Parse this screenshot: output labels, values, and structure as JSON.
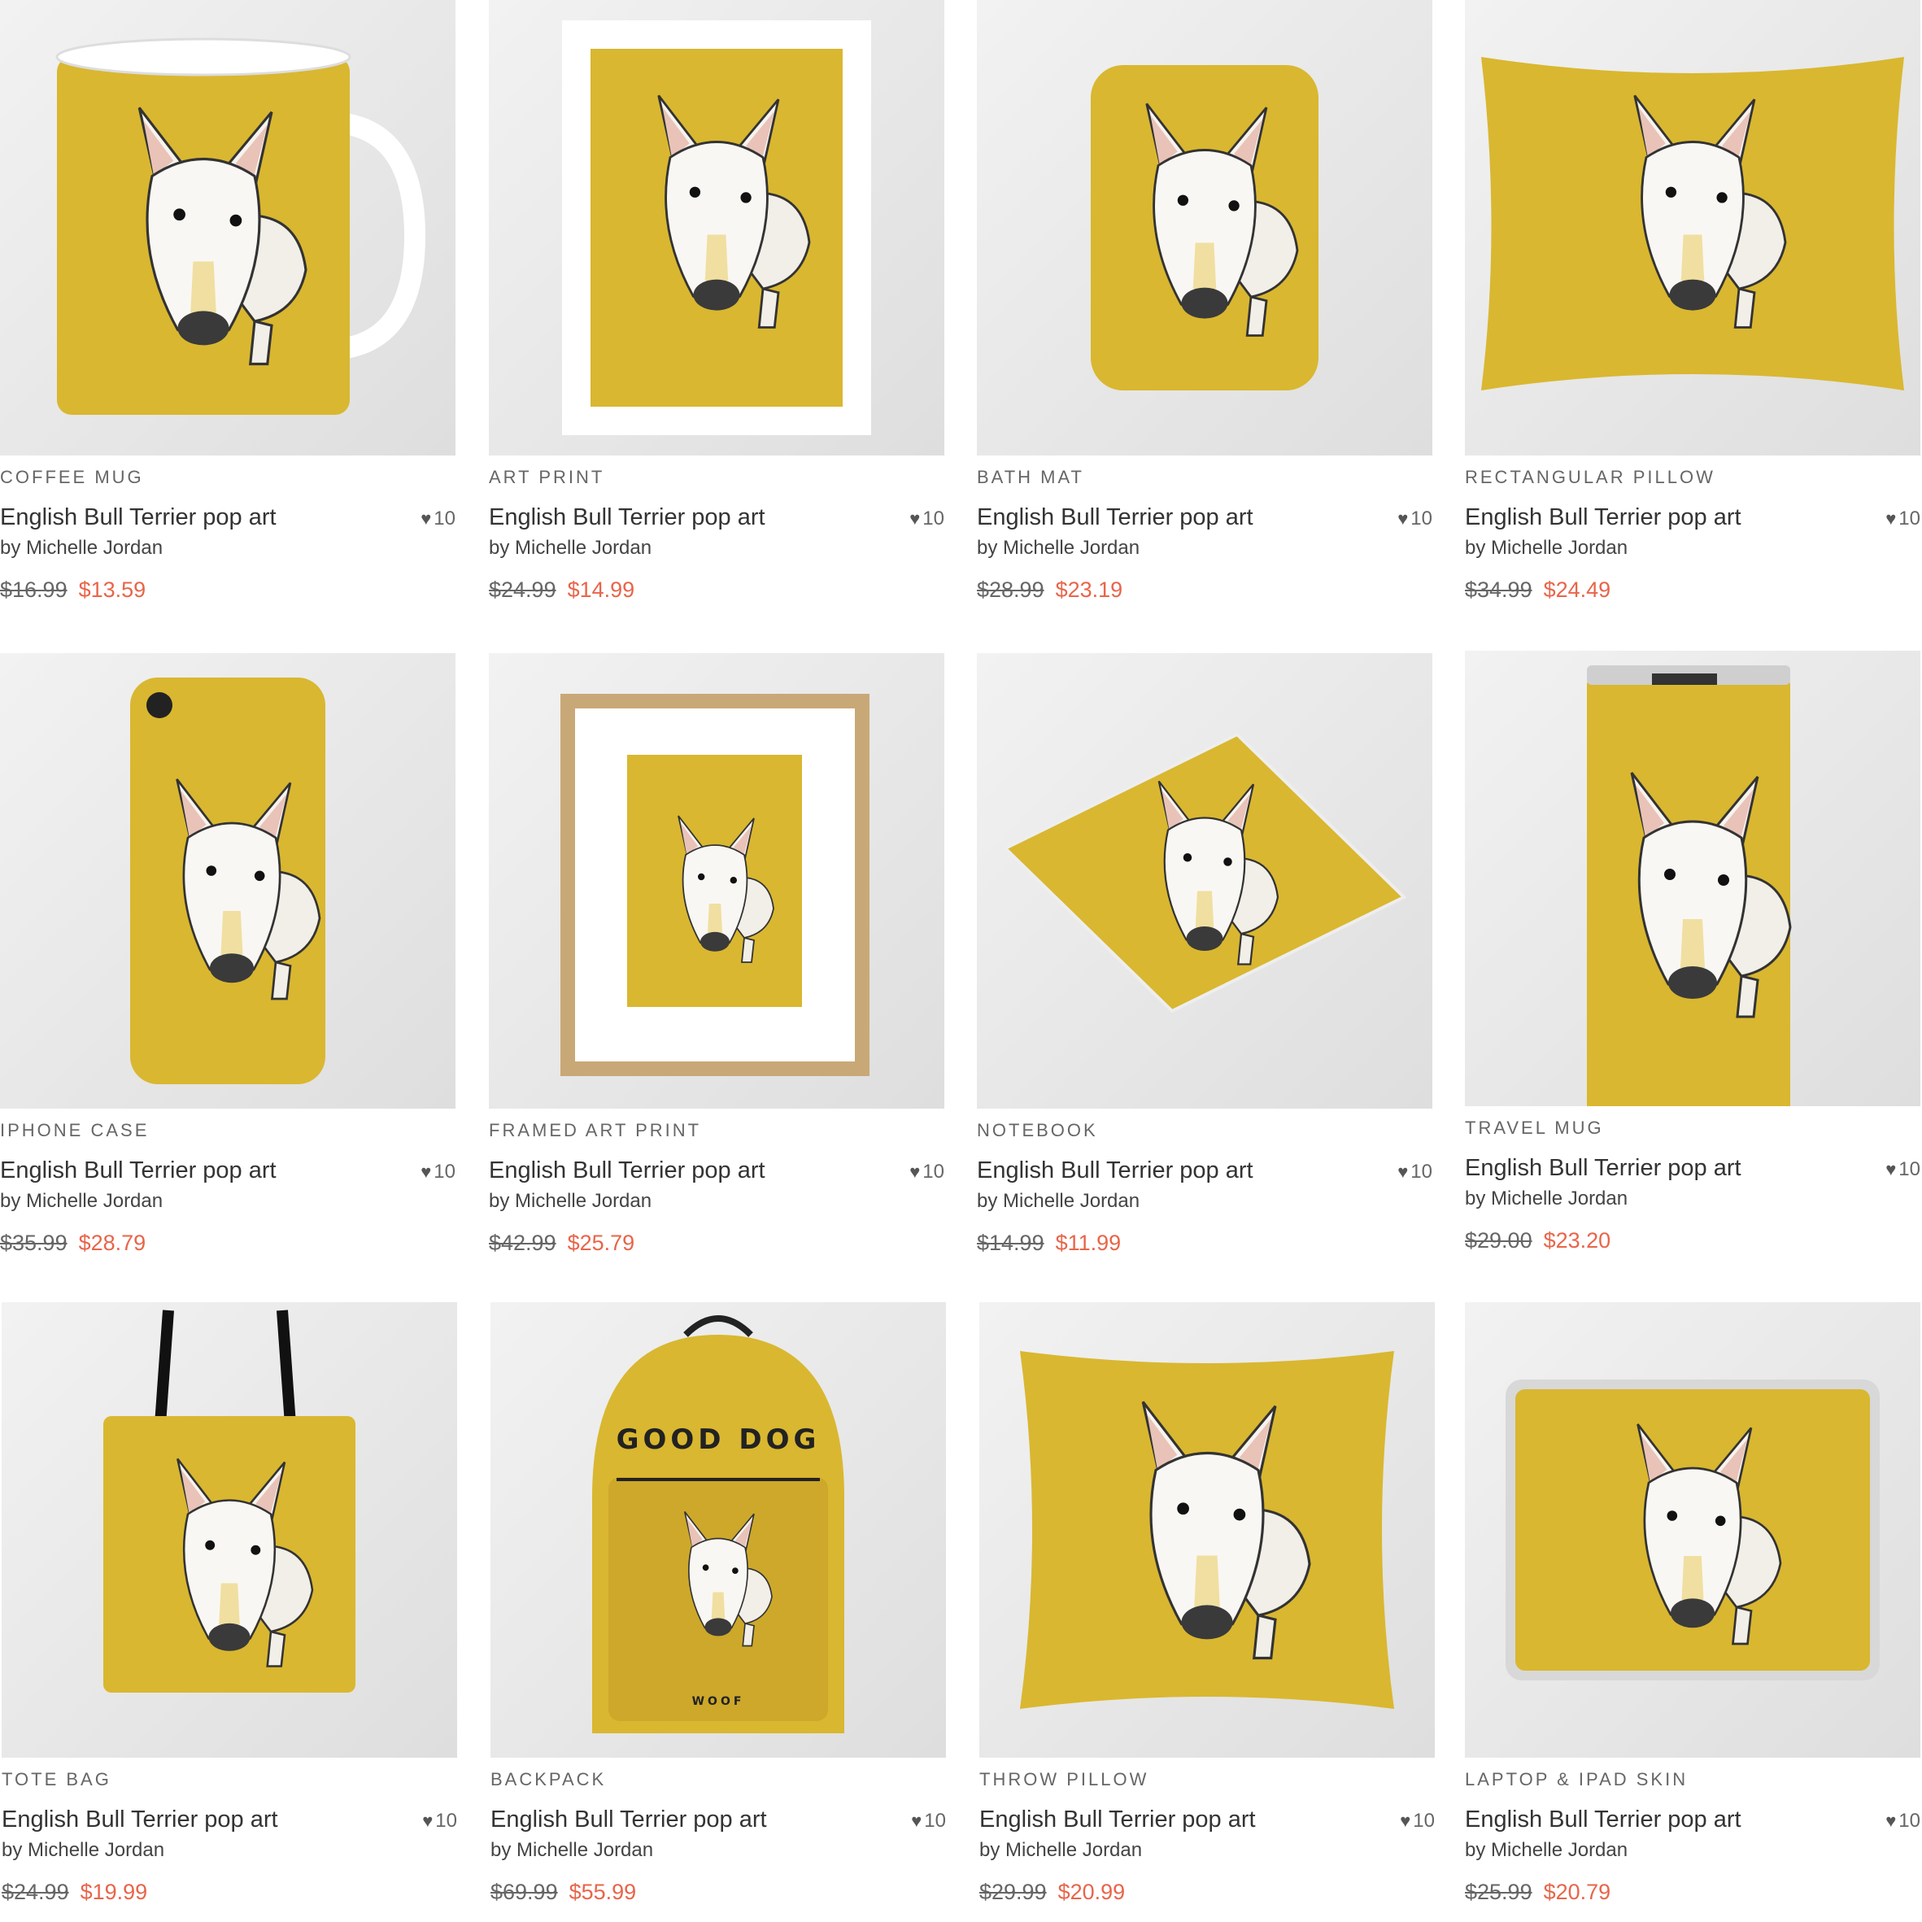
{
  "colors": {
    "price_sale": "#e8654a",
    "background_art": "#d9b730",
    "text": "#333333"
  },
  "products": [
    {
      "type": "COFFEE MUG",
      "title": "English Bull Terrier pop art",
      "artist": "by Michelle Jordan",
      "likes": "10",
      "old_price": "$16.99",
      "price": "$13.59",
      "shape": "mug"
    },
    {
      "type": "ART PRINT",
      "title": "English Bull Terrier pop art",
      "artist": "by Michelle Jordan",
      "likes": "10",
      "old_price": "$24.99",
      "price": "$14.99",
      "shape": "print"
    },
    {
      "type": "BATH MAT",
      "title": "English Bull Terrier pop art",
      "artist": "by Michelle Jordan",
      "likes": "10",
      "old_price": "$28.99",
      "price": "$23.19",
      "shape": "mat"
    },
    {
      "type": "RECTANGULAR PILLOW",
      "title": "English Bull Terrier pop art",
      "artist": "by Michelle Jordan",
      "likes": "10",
      "old_price": "$34.99",
      "price": "$24.49",
      "shape": "rectpillow"
    },
    {
      "type": "IPHONE CASE",
      "title": "English Bull Terrier pop art",
      "artist": "by Michelle Jordan",
      "likes": "10",
      "old_price": "$35.99",
      "price": "$28.79",
      "shape": "phone"
    },
    {
      "type": "FRAMED ART PRINT",
      "title": "English Bull Terrier pop art",
      "artist": "by Michelle Jordan",
      "likes": "10",
      "old_price": "$42.99",
      "price": "$25.79",
      "shape": "framed"
    },
    {
      "type": "NOTEBOOK",
      "title": "English Bull Terrier pop art",
      "artist": "by Michelle Jordan",
      "likes": "10",
      "old_price": "$14.99",
      "price": "$11.99",
      "shape": "notebook"
    },
    {
      "type": "TRAVEL MUG",
      "title": "English Bull Terrier pop art",
      "artist": "by Michelle Jordan",
      "likes": "10",
      "old_price": "$29.00",
      "price": "$23.20",
      "shape": "travelmug"
    },
    {
      "type": "TOTE BAG",
      "title": "English Bull Terrier pop art",
      "artist": "by Michelle Jordan",
      "likes": "10",
      "old_price": "$24.99",
      "price": "$19.99",
      "shape": "tote"
    },
    {
      "type": "BACKPACK",
      "title": "English Bull Terrier pop art",
      "artist": "by Michelle Jordan",
      "likes": "10",
      "old_price": "$69.99",
      "price": "$55.99",
      "shape": "backpack",
      "print_text": "GOOD DOG",
      "print_subtext": "WOOF"
    },
    {
      "type": "THROW PILLOW",
      "title": "English Bull Terrier pop art",
      "artist": "by Michelle Jordan",
      "likes": "10",
      "old_price": "$29.99",
      "price": "$20.99",
      "shape": "throwpillow"
    },
    {
      "type": "LAPTOP & IPAD SKIN",
      "title": "English Bull Terrier pop art",
      "artist": "by Michelle Jordan",
      "likes": "10",
      "old_price": "$25.99",
      "price": "$20.79",
      "shape": "ipad"
    }
  ]
}
